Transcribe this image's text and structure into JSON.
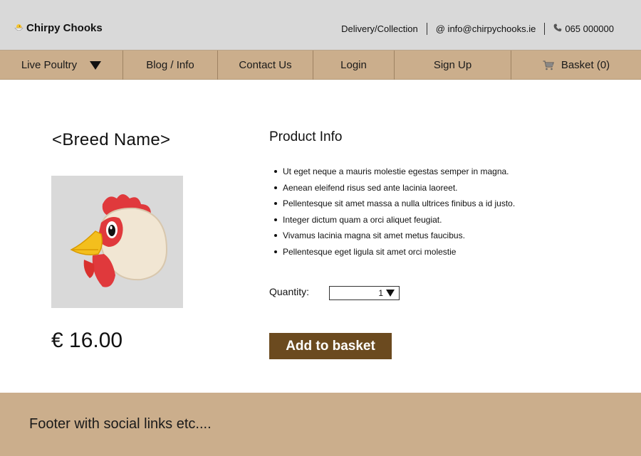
{
  "header": {
    "brand_name": "Chirpy Chooks",
    "delivery_label": "Delivery/Collection",
    "email": "@ info@chirpychooks.ie",
    "phone": "065 000000"
  },
  "nav": {
    "items": [
      {
        "label": "Live Poultry",
        "icon": "triangle-down-icon"
      },
      {
        "label": "Blog / Info"
      },
      {
        "label": "Contact Us"
      },
      {
        "label": "Login"
      },
      {
        "label": "Sign Up"
      },
      {
        "label": "Basket (0)",
        "icon": "cart-icon"
      }
    ]
  },
  "product": {
    "breed_name": "<Breed Name>",
    "image_icon": "chicken-head-icon",
    "price": "€ 16.00",
    "info_title": "Product Info",
    "bullets": [
      "Ut eget neque a mauris molestie egestas semper in magna.",
      "Aenean eleifend risus sed ante lacinia laoreet.",
      "Pellentesque sit amet massa a nulla ultrices finibus a id justo.",
      "Integer dictum quam a orci aliquet feugiat.",
      "Vivamus lacinia magna sit amet metus faucibus.",
      "Pellentesque eget ligula sit amet orci molestie"
    ],
    "quantity_label": "Quantity:",
    "quantity_value": "1",
    "add_button": "Add to basket"
  },
  "footer": {
    "text": "Footer with social links etc...."
  },
  "colors": {
    "header_bg": "#d9d9d9",
    "nav_bg": "#cbae8c",
    "button_bg": "#6b4a1f",
    "footer_bg": "#cbae8c"
  }
}
